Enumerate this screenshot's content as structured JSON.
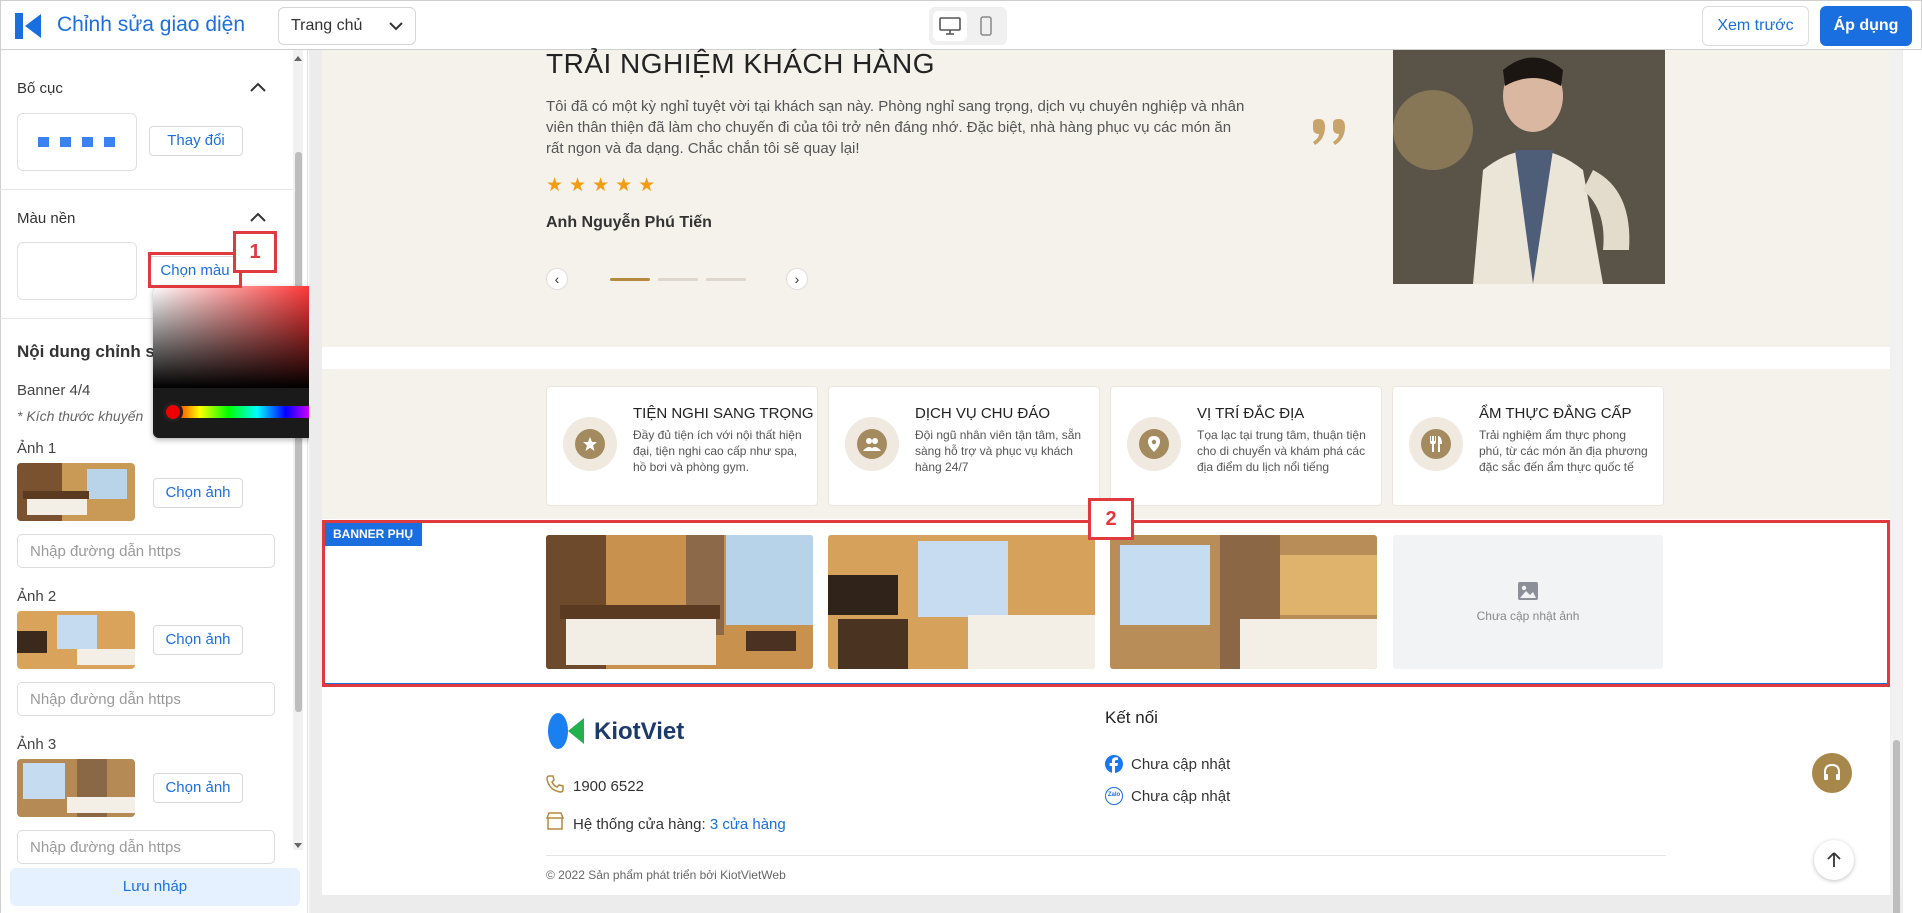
{
  "header": {
    "title": "Chỉnh sửa giao diện",
    "page_select": "Trang chủ",
    "preview_label": "Xem trước",
    "apply_label": "Áp dụng"
  },
  "sidebar": {
    "layout_title": "Bố cục",
    "change_label": "Thay đổi",
    "bg_title": "Màu nền",
    "choose_color": "Chọn màu",
    "content_title": "Nội dung chỉnh sửa",
    "banner_count": "Banner 4/4",
    "size_hint": "* Kích thước khuyến",
    "images": [
      {
        "label": "Ảnh 1",
        "button": "Chọn ảnh",
        "placeholder": "Nhập đường dẫn https"
      },
      {
        "label": "Ảnh 2",
        "button": "Chọn ảnh",
        "placeholder": "Nhập đường dẫn https"
      },
      {
        "label": "Ảnh 3",
        "button": "Chọn ảnh",
        "placeholder": "Nhập đường dẫn https"
      }
    ],
    "save_draft": "Lưu nháp"
  },
  "testimonial": {
    "title": "TRẢI NGHIỆM KHÁCH HÀNG",
    "text": "Tôi đã có một kỳ nghỉ tuyệt vời tại khách sạn này. Phòng nghỉ sang trọng, dịch vụ chuyên nghiệp và nhân viên thân thiện đã làm cho chuyến đi của tôi trở nên đáng nhớ. Đặc biệt, nhà hàng phục vụ các món ăn rất ngon và đa dạng. Chắc chắn tôi sẽ quay lại!",
    "stars": "★★★★★",
    "rating": 5,
    "name": "Anh Nguyễn Phú Tiến"
  },
  "features": [
    {
      "title": "TIỆN NGHI SANG TRỌNG",
      "desc": "Đầy đủ tiện ích với nội thất hiện đại, tiện nghi cao cấp như spa, hồ bơi và phòng gym.",
      "icon": "star-icon"
    },
    {
      "title": "DỊCH VỤ CHU ĐÁO",
      "desc": "Đội ngũ nhân viên tận tâm, sẵn sàng hỗ trợ và phục vụ khách hàng 24/7",
      "icon": "people-icon"
    },
    {
      "title": "VỊ TRÍ ĐẮC ĐỊA",
      "desc": "Tọa lạc tại trung tâm, thuận tiện cho di chuyển và khám phá các địa điểm du lịch nổi tiếng",
      "icon": "location-icon"
    },
    {
      "title": "ẨM THỰC ĐẲNG CẤP",
      "desc": "Trải nghiệm ẩm thực phong phú, từ các món ăn địa phương đặc sắc đến ẩm thực quốc tế",
      "icon": "utensils-icon"
    }
  ],
  "banner": {
    "tag": "BANNER PHỤ",
    "no_image": "Chưa cập nhật ảnh"
  },
  "footer": {
    "brand": "KiotViet",
    "phone": "1900 6522",
    "stores_label": "Hệ thống cửa hàng:",
    "stores_link": "3 cửa hàng",
    "connect_title": "Kết nối",
    "facebook": "Chưa cập nhật",
    "zalo": "Chưa cập nhật",
    "zalo_icon_text": "Zalo",
    "copyright": "© 2022 Sản phẩm phát triển bởi KiotVietWeb"
  },
  "annotations": {
    "one": "1",
    "two": "2"
  },
  "colors": {
    "accent": "#1a6fe0",
    "gold": "#a38a5f",
    "annotation": "#e0393e"
  }
}
